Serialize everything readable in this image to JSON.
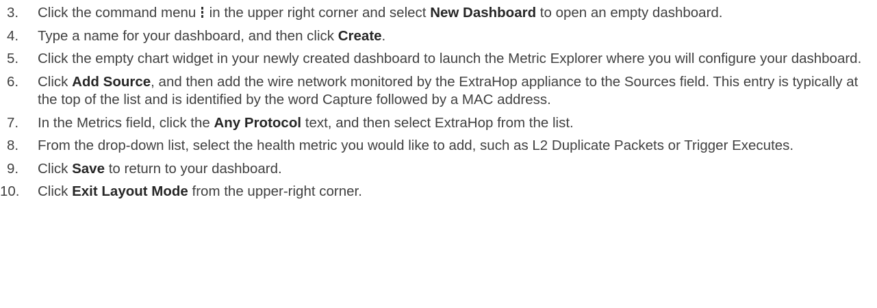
{
  "steps": [
    {
      "num": "3.",
      "parts": [
        {
          "t": "Click the command menu "
        },
        {
          "icon": "vertical-ellipsis-menu-icon"
        },
        {
          "t": " in the upper right corner and select "
        },
        {
          "t": "New Dashboard",
          "b": true
        },
        {
          "t": " to open an empty dashboard."
        }
      ]
    },
    {
      "num": "4.",
      "parts": [
        {
          "t": "Type a name for your dashboard, and then click "
        },
        {
          "t": "Create",
          "b": true
        },
        {
          "t": "."
        }
      ]
    },
    {
      "num": "5.",
      "parts": [
        {
          "t": "Click the empty chart widget in your newly created dashboard to launch the Metric Explorer where you will configure your dashboard."
        }
      ]
    },
    {
      "num": "6.",
      "parts": [
        {
          "t": "Click "
        },
        {
          "t": "Add Source",
          "b": true
        },
        {
          "t": ", and then add the wire network monitored by the ExtraHop appliance to the Sources field. This entry is typically at the top of the list and is identified by the word Capture followed by a MAC address."
        }
      ]
    },
    {
      "num": "7.",
      "parts": [
        {
          "t": "In the Metrics field, click the "
        },
        {
          "t": "Any Protocol",
          "b": true
        },
        {
          "t": " text, and then select ExtraHop from the list."
        }
      ]
    },
    {
      "num": "8.",
      "parts": [
        {
          "t": "From the drop-down list, select the health metric you would like to add, such as L2 Duplicate Packets or Trigger Executes."
        }
      ]
    },
    {
      "num": "9.",
      "parts": [
        {
          "t": "Click "
        },
        {
          "t": "Save",
          "b": true
        },
        {
          "t": " to return to your dashboard."
        }
      ]
    },
    {
      "num": "10.",
      "parts": [
        {
          "t": "Click "
        },
        {
          "t": "Exit Layout Mode",
          "b": true
        },
        {
          "t": " from the upper-right corner."
        }
      ]
    }
  ]
}
